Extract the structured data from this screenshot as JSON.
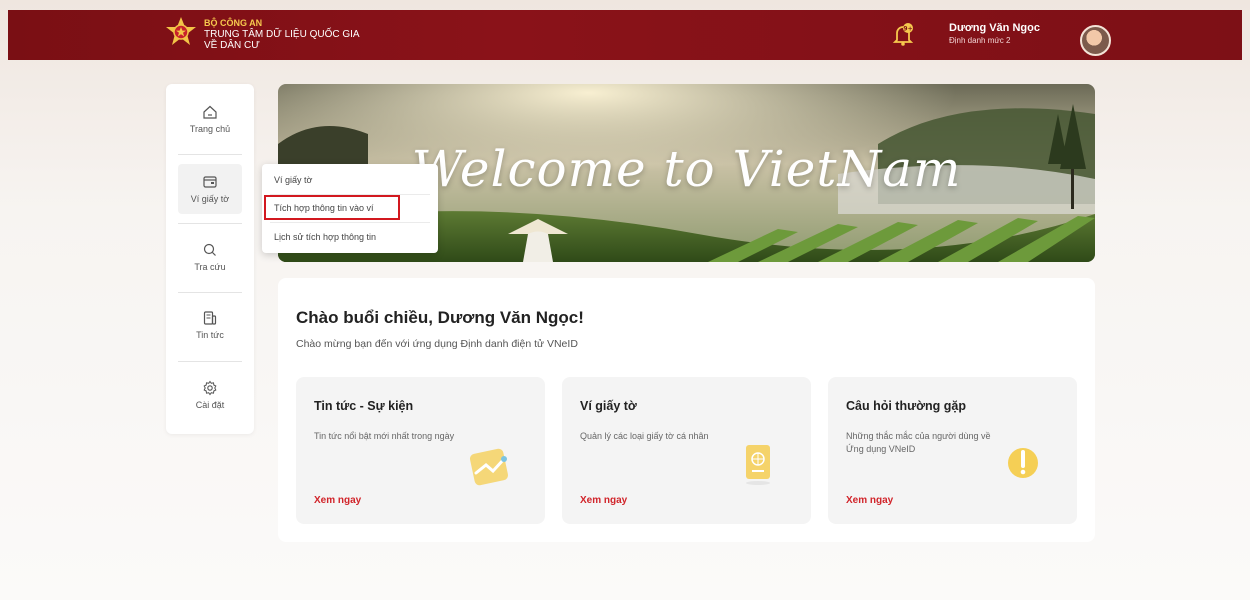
{
  "header": {
    "org_line1": "BỘ CÔNG AN",
    "org_line2": "TRUNG TÂM DỮ LIỆU QUỐC GIA",
    "org_line3": "VỀ DÂN CƯ",
    "notification_icon": "bell-icon",
    "user_name": "Dương Văn Ngọc",
    "user_level": "Định danh mức 2"
  },
  "sidebar": {
    "items": [
      {
        "label": "Trang chủ",
        "icon": "home-icon"
      },
      {
        "label": "Ví giấy tờ",
        "icon": "wallet-icon"
      },
      {
        "label": "Tra cứu",
        "icon": "search-icon"
      },
      {
        "label": "Tin tức",
        "icon": "news-icon"
      },
      {
        "label": "Cài đặt",
        "icon": "gear-icon"
      }
    ]
  },
  "dropdown": {
    "items": [
      "Ví giấy tờ",
      "Tích hợp thông tin vào ví",
      "Lịch sử tích hợp thông tin"
    ]
  },
  "banner": {
    "title": "Welcome to VietNam"
  },
  "main": {
    "greeting": "Chào buổi chiều, Dương Văn Ngọc!",
    "subgreeting": "Chào mừng bạn đến với ứng dụng Định danh điện tử VNeID",
    "cards": [
      {
        "title": "Tin tức - Sự kiện",
        "desc": "Tin tức nổi bật mới nhất trong ngày",
        "link": "Xem ngay",
        "icon": "news-feature-icon"
      },
      {
        "title": "Ví giấy tờ",
        "desc": "Quản lý các loại giấy tờ cá nhân",
        "link": "Xem ngay",
        "icon": "passport-icon"
      },
      {
        "title": "Câu hỏi thường gặp",
        "desc": "Những thắc mắc của người dùng về Ứng dụng VNeID",
        "link": "Xem ngay",
        "icon": "faq-exclamation-icon"
      }
    ]
  },
  "colors": {
    "header_bg": "#7a0f14",
    "accent_red": "#d1242a",
    "gold": "#f6c94e"
  }
}
